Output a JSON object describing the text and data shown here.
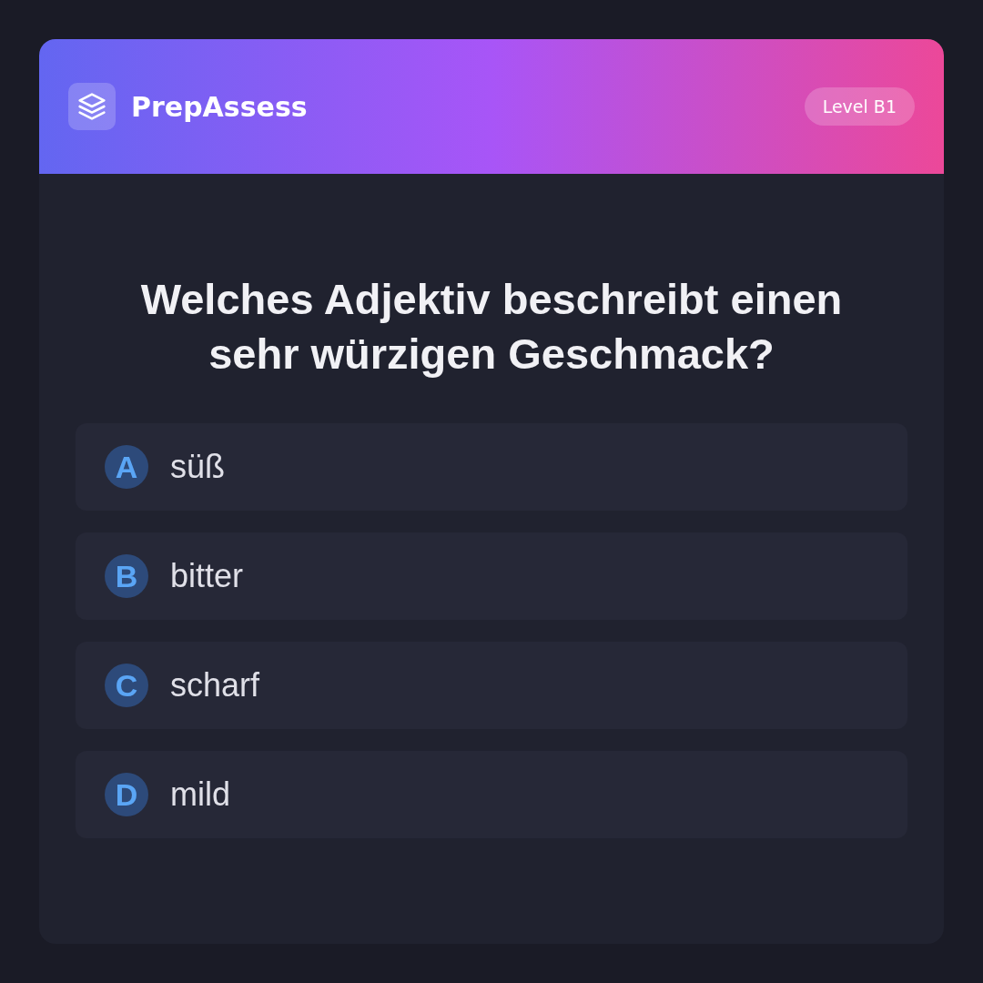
{
  "header": {
    "brand": "PrepAssess",
    "level_badge": "Level B1"
  },
  "question": "Welches Adjektiv beschreibt einen sehr würzigen Geschmack?",
  "options": [
    {
      "letter": "A",
      "text": "süß"
    },
    {
      "letter": "B",
      "text": "bitter"
    },
    {
      "letter": "C",
      "text": "scharf"
    },
    {
      "letter": "D",
      "text": "mild"
    }
  ]
}
